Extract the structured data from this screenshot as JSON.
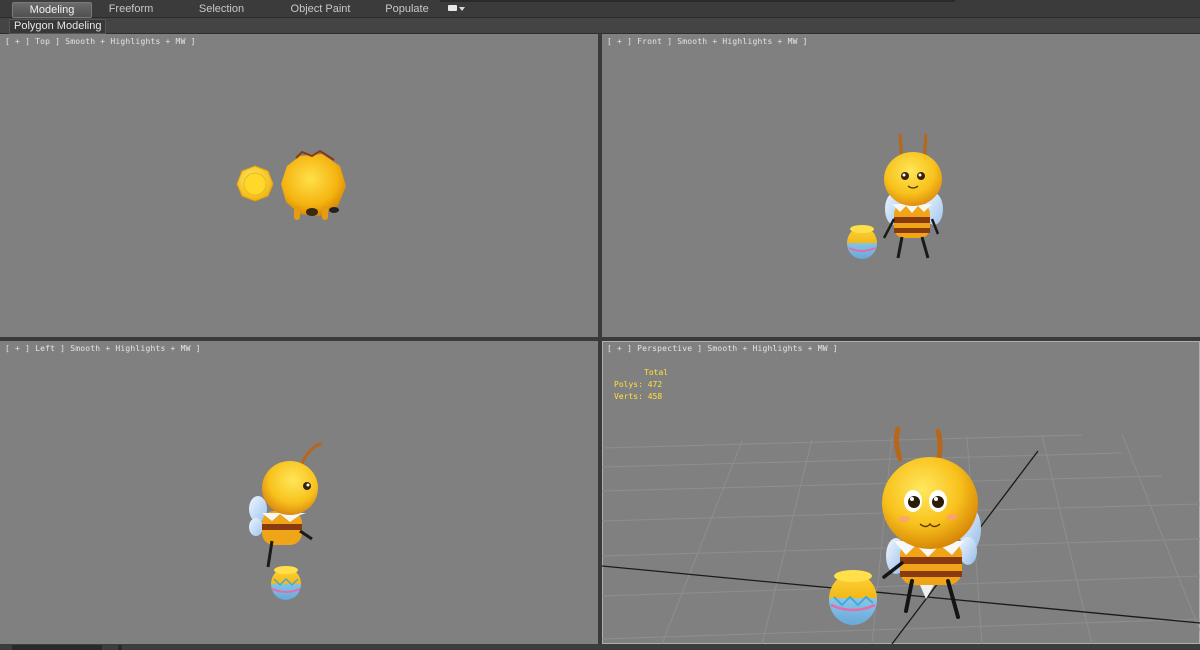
{
  "ribbon": {
    "tabs": [
      {
        "label": "Modeling",
        "active": true
      },
      {
        "label": "Freeform",
        "active": false
      },
      {
        "label": "Selection",
        "active": false
      },
      {
        "label": "Object Paint",
        "active": false
      },
      {
        "label": "Populate",
        "active": false
      }
    ],
    "more_icon": "display-options-icon",
    "panel_label": "Polygon Modeling"
  },
  "viewports": {
    "top": {
      "label": "[ + ] Top ] Smooth + Highlights + MW ]"
    },
    "front": {
      "label": "[ + ] Front ] Smooth + Highlights + MW ]"
    },
    "left": {
      "label": "[ + ] Left ] Smooth + Highlights + MW ]"
    },
    "perspective": {
      "label": "[ + ] Perspective ] Smooth + Highlights + MW ]",
      "stats": {
        "header": "Total",
        "polys": "Polys: 472",
        "verts": "Verts: 458"
      }
    }
  },
  "colors": {
    "viewport_bg": "#808080",
    "bee_yellow": "#f7c21a",
    "bee_orange": "#e08a12",
    "stats_text": "#ffe23a",
    "ui_dark": "#444444"
  }
}
